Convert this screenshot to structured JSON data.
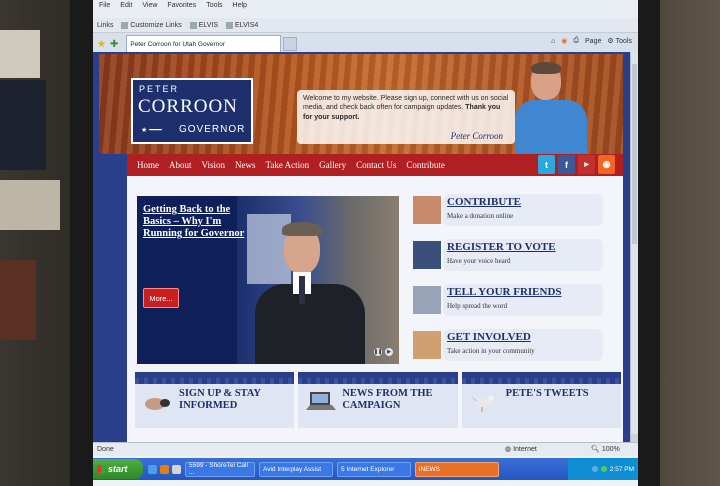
{
  "browser": {
    "menu": [
      "File",
      "Edit",
      "View",
      "Favorites",
      "Tools",
      "Help"
    ],
    "links_label": "Links",
    "links": [
      "Customize Links",
      "ELVIS",
      "ELVIS4"
    ],
    "tab_title": "Peter Corroon for Utah Governor",
    "commands": [
      "Page",
      "Tools"
    ],
    "status": "Done",
    "zone": "Internet",
    "zoom": "100%"
  },
  "header": {
    "logo_first": "PETER",
    "logo_last": "CORROON",
    "logo_office": "GOVERNOR",
    "welcome_text": "Welcome to my website. Please sign up, connect with us on social media, and check back often for campaign updates.",
    "welcome_thanks": "Thank you for your support.",
    "signature": "Peter Corroon"
  },
  "nav": {
    "items": [
      "Home",
      "About",
      "Vision",
      "News",
      "Take Action",
      "Gallery",
      "Contact Us",
      "Contribute"
    ],
    "social": [
      {
        "icon": "twitter-icon",
        "glyph": "t",
        "color": "#29a9e0"
      },
      {
        "icon": "facebook-icon",
        "glyph": "f",
        "color": "#3b5998"
      },
      {
        "icon": "youtube-icon",
        "glyph": "▶",
        "color": "#c4302b"
      },
      {
        "icon": "rss-icon",
        "glyph": "◉",
        "color": "#f26522"
      }
    ]
  },
  "feature": {
    "headline": "Getting Back to the Basics – Why I'm Running for Governor",
    "more_label": "More..."
  },
  "actions": [
    {
      "title": "CONTRIBUTE",
      "sub": "Make a donation online"
    },
    {
      "title": "REGISTER TO VOTE",
      "sub": "Have your voice heard"
    },
    {
      "title": "TELL YOUR FRIENDS",
      "sub": "Help spread the word"
    },
    {
      "title": "GET INVOLVED",
      "sub": "Take action in your community"
    }
  ],
  "bottom": [
    {
      "label": "SIGN UP & STAY INFORMED"
    },
    {
      "label": "NEWS FROM THE CAMPAIGN"
    },
    {
      "label": "PETE'S TWEETS"
    }
  ],
  "taskbar": {
    "start_label": "start",
    "tasks": [
      "5599 - ShoreTel Call ...",
      "Avid Interplay Assist",
      "5 Internet Explorer",
      "iNEWS"
    ],
    "clock": "2:57 PM"
  }
}
